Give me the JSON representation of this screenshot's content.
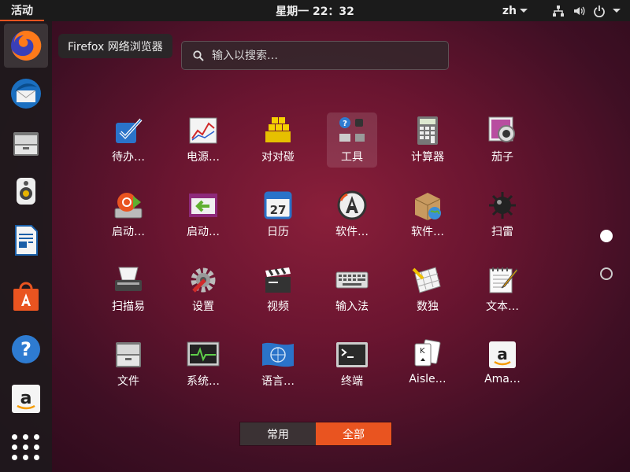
{
  "topbar": {
    "activities": "活动",
    "clock": "星期一 22：32",
    "language": "zh"
  },
  "tooltip": "Firefox 网络浏览器",
  "search": {
    "placeholder": "输入以搜索…"
  },
  "apps": [
    {
      "label": "待办…"
    },
    {
      "label": "电源…"
    },
    {
      "label": "对对碰"
    },
    {
      "label": "工具"
    },
    {
      "label": "计算器"
    },
    {
      "label": "茄子"
    },
    {
      "label": "启动…"
    },
    {
      "label": "启动…"
    },
    {
      "label": "日历",
      "icon_text": "27"
    },
    {
      "label": "软件…"
    },
    {
      "label": "软件…"
    },
    {
      "label": "扫雷"
    },
    {
      "label": "扫描易"
    },
    {
      "label": "设置"
    },
    {
      "label": "视频"
    },
    {
      "label": "输入法"
    },
    {
      "label": "数独"
    },
    {
      "label": "文本…"
    },
    {
      "label": "文件"
    },
    {
      "label": "系统…"
    },
    {
      "label": "语言…"
    },
    {
      "label": "终端"
    },
    {
      "label": "Aisle…"
    },
    {
      "label": "Ama…"
    }
  ],
  "tabs": {
    "frequent": "常用",
    "all": "全部"
  },
  "colors": {
    "accent": "#e95420",
    "topbar": "#1b1b1b"
  }
}
